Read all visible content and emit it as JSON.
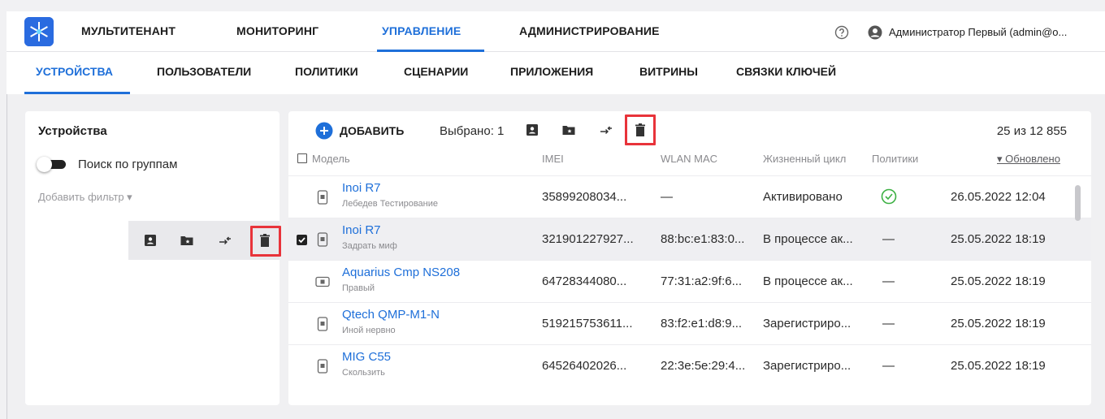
{
  "topnav": {
    "items": [
      "МУЛЬТИТЕНАНТ",
      "МОНИТОРИНГ",
      "УПРАВЛЕНИЕ",
      "АДМИНИСТРИРОВАНИЕ"
    ],
    "active": "УПРАВЛЕНИЕ",
    "user": "Администратор Первый (admin@o..."
  },
  "subnav": {
    "items": [
      "УСТРОЙСТВА",
      "ПОЛЬЗОВАТЕЛИ",
      "ПОЛИТИКИ",
      "СЦЕНАРИИ",
      "ПРИЛОЖЕНИЯ",
      "ВИТРИНЫ",
      "СВЯЗКИ КЛЮЧЕЙ"
    ],
    "active": "УСТРОЙСТВА"
  },
  "left_panel": {
    "title": "Устройства",
    "toggle_label": "Поиск по группам",
    "add_filter": "Добавить фильтр ▾"
  },
  "toolbar": {
    "add_label": "ДОБАВИТЬ",
    "selected_label": "Выбрано: 1",
    "count_label": "25 из 12 855"
  },
  "table": {
    "headers": [
      "Модель",
      "IMEI",
      "WLAN MAC",
      "Жизненный цикл",
      "Политики",
      "▾ Обновлено"
    ],
    "rows": [
      {
        "model": "Inoi R7",
        "sub": "Лебедев Тестирование",
        "imei": "35899208034...",
        "mac": "—",
        "lifecycle": "Активировано",
        "policy": "ok",
        "updated": "26.05.2022 12:04",
        "selected": false,
        "device": "phone"
      },
      {
        "model": "Inoi R7",
        "sub": "Задрать миф",
        "imei": "321901227927...",
        "mac": "88:bc:e1:83:0...",
        "lifecycle": "В процессе ак...",
        "policy": "—",
        "updated": "25.05.2022 18:19",
        "selected": true,
        "device": "phone"
      },
      {
        "model": "Aquarius Cmp NS208",
        "sub": "Правый",
        "imei": "64728344080...",
        "mac": "77:31:a2:9f:6...",
        "lifecycle": "В процессе ак...",
        "policy": "—",
        "updated": "25.05.2022 18:19",
        "selected": false,
        "device": "tablet"
      },
      {
        "model": "Qtech QMP-M1-N",
        "sub": "Иной нервно",
        "imei": "519215753611...",
        "mac": "83:f2:e1:d8:9...",
        "lifecycle": "Зарегистриро...",
        "policy": "—",
        "updated": "25.05.2022 18:19",
        "selected": false,
        "device": "phone"
      },
      {
        "model": "MIG C55",
        "sub": "Скользить",
        "imei": "64526402026...",
        "mac": "22:3e:5e:29:4...",
        "lifecycle": "Зарегистриро...",
        "policy": "—",
        "updated": "25.05.2022 18:19",
        "selected": false,
        "device": "phone"
      }
    ]
  },
  "colors": {
    "accent": "#1e6fd9",
    "highlight": "#e8333a",
    "ok": "#3cb043"
  }
}
